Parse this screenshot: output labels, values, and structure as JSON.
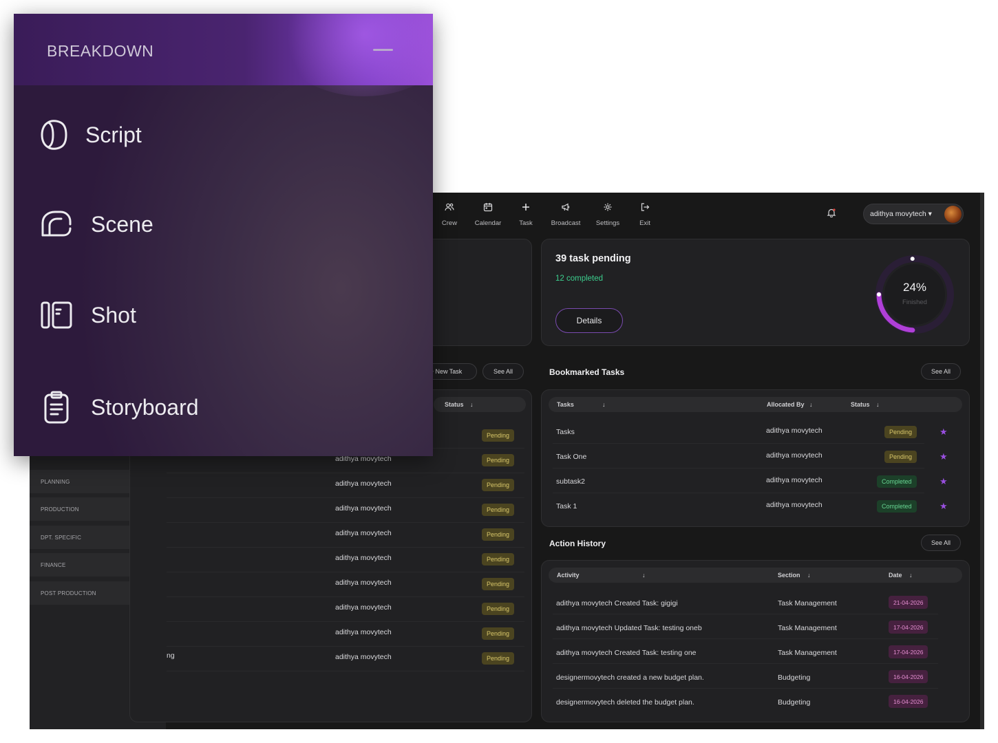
{
  "breakdown": {
    "title": "BREAKDOWN",
    "items": [
      {
        "label": "Script",
        "icon": "script-icon"
      },
      {
        "label": "Scene",
        "icon": "scene-icon"
      },
      {
        "label": "Shot",
        "icon": "shot-icon"
      },
      {
        "label": "Storyboard",
        "icon": "storyboard-icon"
      }
    ]
  },
  "sidebar": {
    "items": [
      {
        "label": "PLANNING"
      },
      {
        "label": "PRODUCTION"
      },
      {
        "label": "DPT. SPECIFIC"
      },
      {
        "label": "FINANCE"
      },
      {
        "label": "POST PRODUCTION"
      }
    ]
  },
  "nav": {
    "items": [
      {
        "label": "Crew",
        "icon": "crew-icon"
      },
      {
        "label": "Calendar",
        "icon": "calendar-icon"
      },
      {
        "label": "Task",
        "icon": "plus-icon"
      },
      {
        "label": "Broadcast",
        "icon": "megaphone-icon"
      },
      {
        "label": "Settings",
        "icon": "gear-icon"
      },
      {
        "label": "Exit",
        "icon": "exit-icon"
      }
    ],
    "user_name": "adithya movytech ▾"
  },
  "pending": {
    "title": "39 task pending",
    "completed": "12 completed",
    "details_label": "Details",
    "percent_text": "24%",
    "percent_value": 0.24,
    "finished_label": "Finished"
  },
  "tasks_panel": {
    "new_task_label": "+ New Task",
    "see_all_label": "See All",
    "status_header": "Status",
    "row_partial_label": "ng",
    "rows": [
      {
        "allocated": "",
        "status": "Pending"
      },
      {
        "allocated": "adithya movytech",
        "status": "Pending"
      },
      {
        "allocated": "adithya movytech",
        "status": "Pending"
      },
      {
        "allocated": "adithya movytech",
        "status": "Pending"
      },
      {
        "allocated": "adithya movytech",
        "status": "Pending"
      },
      {
        "allocated": "adithya movytech",
        "status": "Pending"
      },
      {
        "allocated": "adithya movytech",
        "status": "Pending"
      },
      {
        "allocated": "adithya movytech",
        "status": "Pending"
      },
      {
        "allocated": "adithya movytech",
        "status": "Pending"
      },
      {
        "allocated": "adithya movytech",
        "status": "Pending"
      }
    ]
  },
  "bookmarked": {
    "title": "Bookmarked Tasks",
    "see_all_label": "See All",
    "headers": {
      "tasks": "Tasks",
      "allocated": "Allocated By",
      "status": "Status"
    },
    "rows": [
      {
        "task": "Tasks",
        "allocated": "adithya movytech",
        "status": "Pending"
      },
      {
        "task": "Task One",
        "allocated": "adithya movytech",
        "status": "Pending"
      },
      {
        "task": "subtask2",
        "allocated": "adithya movytech",
        "status": "Completed"
      },
      {
        "task": "Task 1",
        "allocated": "adithya movytech",
        "status": "Completed"
      }
    ]
  },
  "history": {
    "title": "Action History",
    "see_all_label": "See All",
    "headers": {
      "activity": "Activity",
      "section": "Section",
      "date": "Date"
    },
    "rows": [
      {
        "activity": "adithya movytech Created Task: gigigi",
        "section": "Task Management",
        "date": "21-04-2026"
      },
      {
        "activity": "adithya movytech Updated Task: testing oneb",
        "section": "Task Management",
        "date": "17-04-2026"
      },
      {
        "activity": "adithya movytech Created Task: testing one",
        "section": "Task Management",
        "date": "17-04-2026"
      },
      {
        "activity": "designermovytech created a new budget plan.",
        "section": "Budgeting",
        "date": "16-04-2026"
      },
      {
        "activity": "designermovytech deleted the budget plan.",
        "section": "Budgeting",
        "date": "16-04-2026"
      }
    ]
  },
  "colors": {
    "accent_purple": "#9a4fe0",
    "pending_bg": "#4b4420",
    "completed_bg": "#1c4029",
    "completed_text": "#3ccf8e",
    "date_bg": "#46213f"
  }
}
